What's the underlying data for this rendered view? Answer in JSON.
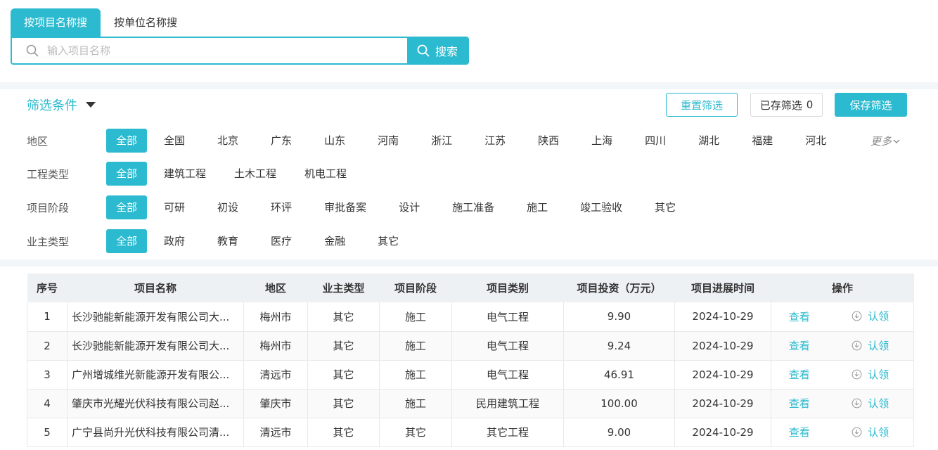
{
  "search": {
    "tabs": [
      "按项目名称搜",
      "按单位名称搜"
    ],
    "placeholder": "输入项目名称",
    "button_label": "搜索"
  },
  "filter": {
    "title": "筛选条件",
    "reset_label": "重置筛选",
    "saved_label": "已存筛选",
    "saved_count": "0",
    "save_label": "保存筛选",
    "more_label": "更多",
    "rows": [
      {
        "label": "地区",
        "options": [
          "全部",
          "全国",
          "北京",
          "广东",
          "山东",
          "河南",
          "浙江",
          "江苏",
          "陕西",
          "上海",
          "四川",
          "湖北",
          "福建",
          "河北"
        ]
      },
      {
        "label": "工程类型",
        "options": [
          "全部",
          "建筑工程",
          "土木工程",
          "机电工程"
        ]
      },
      {
        "label": "项目阶段",
        "options": [
          "全部",
          "可研",
          "初设",
          "环评",
          "审批备案",
          "设计",
          "施工准备",
          "施工",
          "竣工验收",
          "其它"
        ]
      },
      {
        "label": "业主类型",
        "options": [
          "全部",
          "政府",
          "教育",
          "医疗",
          "金融",
          "其它"
        ]
      }
    ]
  },
  "table": {
    "headers": [
      "序号",
      "项目名称",
      "地区",
      "业主类型",
      "项目阶段",
      "项目类别",
      "项目投资（万元）",
      "项目进展时间",
      "操作"
    ],
    "view_label": "查看",
    "claim_label": "认领",
    "rows": [
      [
        "1",
        "长沙驰能新能源开发有限公司大...",
        "梅州市",
        "其它",
        "施工",
        "电气工程",
        "9.90",
        "2024-10-29"
      ],
      [
        "2",
        "长沙驰能新能源开发有限公司大...",
        "梅州市",
        "其它",
        "施工",
        "电气工程",
        "9.24",
        "2024-10-29"
      ],
      [
        "3",
        "广州增城维光新能源开发有限公...",
        "清远市",
        "其它",
        "施工",
        "电气工程",
        "46.91",
        "2024-10-29"
      ],
      [
        "4",
        "肇庆市光耀光伏科技有限公司赵...",
        "肇庆市",
        "其它",
        "施工",
        "民用建筑工程",
        "100.00",
        "2024-10-29"
      ],
      [
        "5",
        "广宁县尚升光伏科技有限公司清...",
        "清远市",
        "其它",
        "其它",
        "其它工程",
        "9.00",
        "2024-10-29"
      ]
    ]
  },
  "colors": {
    "accent": "#2bbacf",
    "band": "#f3f6f9"
  },
  "icons": [
    "search-icon",
    "caret-down-icon",
    "chevron-down-icon",
    "download-icon"
  ]
}
